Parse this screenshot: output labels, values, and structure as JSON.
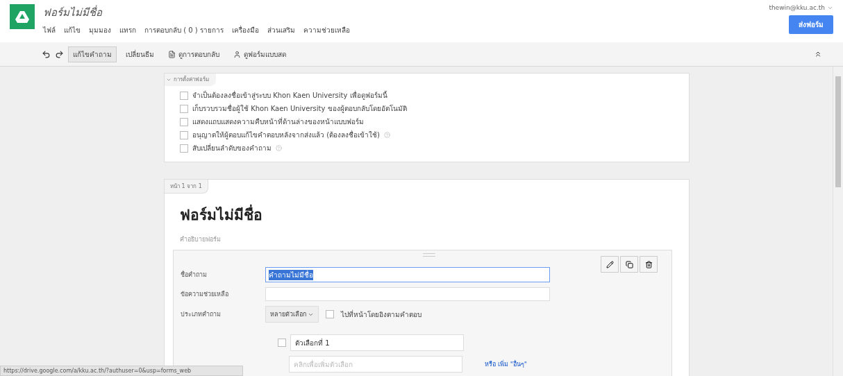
{
  "header": {
    "title": "ฟอร์มไม่มีชื่อ",
    "menu": [
      "ไฟล์",
      "แก้ไข",
      "มุมมอง",
      "แทรก",
      "การตอบกลับ ( 0 ) รายการ",
      "เครื่องมือ",
      "ส่วนเสริม",
      "ความช่วยเหลือ"
    ],
    "account": "thewin@kku.ac.th",
    "send_button": "ส่งฟอร์ม"
  },
  "toolbar": [
    {
      "label": "แก้ไขคำถาม",
      "selected": true,
      "kind": "text"
    },
    {
      "label": "เปลี่ยนธีม",
      "selected": false,
      "kind": "text"
    },
    {
      "label": "ดูการตอบกลับ",
      "selected": false,
      "kind": "responses"
    },
    {
      "label": "ดูฟอร์มแบบสด",
      "selected": false,
      "kind": "live"
    }
  ],
  "settings": {
    "title": "การตั้งค่าฟอร์ม",
    "expanded": true,
    "options": [
      {
        "label": "จำเป็นต้องลงชื่อเข้าสู่ระบบ Khon Kaen University เพื่อดูฟอร์มนี้",
        "checked": false,
        "help": false
      },
      {
        "label": "เก็บรวบรวมชื่อผู้ใช้ Khon Kaen University ของผู้ตอบกลับโดยอัตโนมัติ",
        "checked": false,
        "help": false
      },
      {
        "label": "แสดงแถบแสดงความคืบหน้าที่ด้านล่างของหน้าแบบฟอร์ม",
        "checked": false,
        "help": false
      },
      {
        "label": "อนุญาตให้ผู้ตอบแก้ไขคำตอบหลังจากส่งแล้ว (ต้องลงชื่อเข้าใช้)",
        "checked": false,
        "help": true
      },
      {
        "label": "สับเปลี่ยนลำดับของคำถาม",
        "checked": false,
        "help": true
      }
    ]
  },
  "page": {
    "tab": "หน้า 1 จาก 1",
    "title": "ฟอร์มไม่มีชื่อ",
    "description": "คำอธิบายฟอร์ม",
    "question": {
      "title_label": "ชื่อคำถาม",
      "title_value": "คำถามไม่มีชื่อ",
      "help_label": "ข้อความช่วยเหลือ",
      "type_label": "ประเภทคำถาม",
      "type_value": "หลายตัวเลือก",
      "go_to_page": {
        "label": "ไปที่หน้าโดยอิงตามคำตอบ",
        "checked": false
      },
      "options": [
        "ตัวเลือกที่ 1"
      ],
      "add_option_placeholder": "คลิกเพื่อเพิ่มตัวเลือก",
      "add_other_link": "หรือ เพิ่ม \"อื่นๆ\""
    }
  },
  "status_bar": "https://drive.google.com/a/kku.ac.th/?authuser=0&usp=forms_web"
}
